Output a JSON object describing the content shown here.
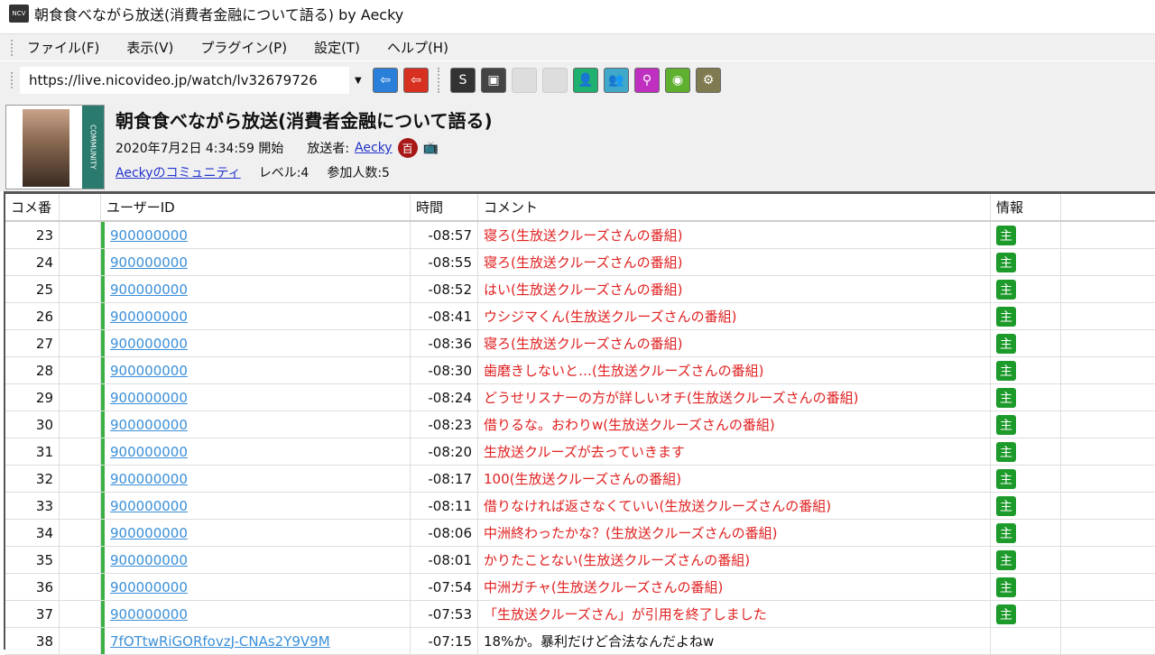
{
  "window": {
    "title": "朝食食べながら放送(消費者金融について語る) by Aecky",
    "icon_text": "NCV"
  },
  "menu": [
    "ファイル(F)",
    "表示(V)",
    "プラグイン(P)",
    "設定(T)",
    "ヘルプ(H)"
  ],
  "toolbar": {
    "url": "https://live.nicovideo.jp/watch/lv32679726"
  },
  "broadcast": {
    "title": "朝食食べながら放送(消費者金融について語る)",
    "start": "2020年7月2日  4:34:59 開始",
    "broadcaster_label": "放送者:",
    "broadcaster": "Aecky",
    "badge": "百",
    "community": "Aeckyのコミュニティ",
    "level": "レベル:4",
    "participants": "参加人数:5",
    "community_tag": "COMMUNITY"
  },
  "table": {
    "headers": [
      "コメ番",
      "",
      "ユーザーID",
      "時間",
      "コメント",
      "情報"
    ],
    "rows": [
      {
        "no": "23",
        "uid": "900000000",
        "time": "-08:57",
        "comment": "寝ろ(生放送クルーズさんの番組)",
        "info": "主",
        "red": true
      },
      {
        "no": "24",
        "uid": "900000000",
        "time": "-08:55",
        "comment": "寝ろ(生放送クルーズさんの番組)",
        "info": "主",
        "red": true
      },
      {
        "no": "25",
        "uid": "900000000",
        "time": "-08:52",
        "comment": "はい(生放送クルーズさんの番組)",
        "info": "主",
        "red": true
      },
      {
        "no": "26",
        "uid": "900000000",
        "time": "-08:41",
        "comment": "ウシジマくん(生放送クルーズさんの番組)",
        "info": "主",
        "red": true
      },
      {
        "no": "27",
        "uid": "900000000",
        "time": "-08:36",
        "comment": "寝ろ(生放送クルーズさんの番組)",
        "info": "主",
        "red": true
      },
      {
        "no": "28",
        "uid": "900000000",
        "time": "-08:30",
        "comment": "歯磨きしないと…(生放送クルーズさんの番組)",
        "info": "主",
        "red": true
      },
      {
        "no": "29",
        "uid": "900000000",
        "time": "-08:24",
        "comment": "どうせリスナーの方が詳しいオチ(生放送クルーズさんの番組)",
        "info": "主",
        "red": true
      },
      {
        "no": "30",
        "uid": "900000000",
        "time": "-08:23",
        "comment": "借りるな。おわりw(生放送クルーズさんの番組)",
        "info": "主",
        "red": true
      },
      {
        "no": "31",
        "uid": "900000000",
        "time": "-08:20",
        "comment": "生放送クルーズが去っていきます",
        "info": "主",
        "red": true
      },
      {
        "no": "32",
        "uid": "900000000",
        "time": "-08:17",
        "comment": "100(生放送クルーズさんの番組)",
        "info": "主",
        "red": true
      },
      {
        "no": "33",
        "uid": "900000000",
        "time": "-08:11",
        "comment": "借りなければ返さなくていい(生放送クルーズさんの番組)",
        "info": "主",
        "red": true
      },
      {
        "no": "34",
        "uid": "900000000",
        "time": "-08:06",
        "comment": "中洲終わったかな？(生放送クルーズさんの番組)",
        "info": "主",
        "red": true
      },
      {
        "no": "35",
        "uid": "900000000",
        "time": "-08:01",
        "comment": "かりたことない(生放送クルーズさんの番組)",
        "info": "主",
        "red": true
      },
      {
        "no": "36",
        "uid": "900000000",
        "time": "-07:54",
        "comment": "中洲ガチャ(生放送クルーズさんの番組)",
        "info": "主",
        "red": true
      },
      {
        "no": "37",
        "uid": "900000000",
        "time": "-07:53",
        "comment": "「生放送クルーズさん」が引用を終了しました",
        "info": "主",
        "red": true
      },
      {
        "no": "38",
        "uid": "7fOTtwRiGORfovzJ-CNAs2Y9V9M",
        "time": "-07:15",
        "comment": "18%か。暴利だけど合法なんだよねw",
        "info": "",
        "red": false
      }
    ]
  },
  "colors": {
    "accent_red": "#e02020",
    "owner_green": "#1c9a2a",
    "link": "#3a8fd8"
  }
}
